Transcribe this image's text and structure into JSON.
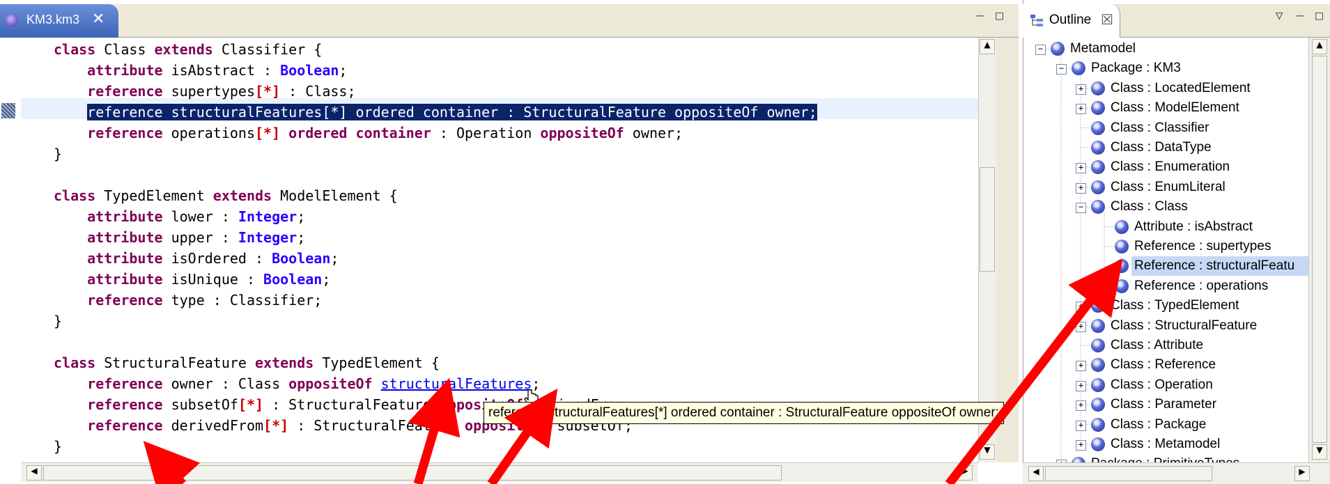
{
  "editor": {
    "tab_title": "KM3.km3",
    "close_glyph": "✕",
    "min_glyph": "–",
    "max_glyph": "□",
    "lines": [
      [
        {
          "t": "class",
          "k": "kw"
        },
        {
          "t": " Class "
        },
        {
          "t": "extends",
          "k": "kw"
        },
        {
          "t": " Classifier {"
        }
      ],
      [
        {
          "t": "    "
        },
        {
          "t": "attribute",
          "k": "kw"
        },
        {
          "t": " isAbstract : "
        },
        {
          "t": "Boolean",
          "k": "kw2"
        },
        {
          "t": ";"
        }
      ],
      [
        {
          "t": "    "
        },
        {
          "t": "reference",
          "k": "kw"
        },
        {
          "t": " supertypes"
        },
        {
          "t": "[*]",
          "k": "br"
        },
        {
          "t": " : Class;"
        }
      ],
      [
        {
          "t": "    "
        },
        {
          "t": "reference structuralFeatures[*] ordered container : StructuralFeature oppositeOf owner;",
          "k": "sel"
        }
      ],
      [
        {
          "t": "    "
        },
        {
          "t": "reference",
          "k": "kw"
        },
        {
          "t": " operations"
        },
        {
          "t": "[*]",
          "k": "br"
        },
        {
          "t": " "
        },
        {
          "t": "ordered container",
          "k": "kw"
        },
        {
          "t": " : Operation "
        },
        {
          "t": "oppositeOf",
          "k": "kw"
        },
        {
          "t": " owner;"
        }
      ],
      [
        {
          "t": "}"
        }
      ],
      [],
      [
        {
          "t": "class",
          "k": "kw"
        },
        {
          "t": " TypedElement "
        },
        {
          "t": "extends",
          "k": "kw"
        },
        {
          "t": " ModelElement {"
        }
      ],
      [
        {
          "t": "    "
        },
        {
          "t": "attribute",
          "k": "kw"
        },
        {
          "t": " lower : "
        },
        {
          "t": "Integer",
          "k": "kw2"
        },
        {
          "t": ";"
        }
      ],
      [
        {
          "t": "    "
        },
        {
          "t": "attribute",
          "k": "kw"
        },
        {
          "t": " upper : "
        },
        {
          "t": "Integer",
          "k": "kw2"
        },
        {
          "t": ";"
        }
      ],
      [
        {
          "t": "    "
        },
        {
          "t": "attribute",
          "k": "kw"
        },
        {
          "t": " isOrdered : "
        },
        {
          "t": "Boolean",
          "k": "kw2"
        },
        {
          "t": ";"
        }
      ],
      [
        {
          "t": "    "
        },
        {
          "t": "attribute",
          "k": "kw"
        },
        {
          "t": " isUnique : "
        },
        {
          "t": "Boolean",
          "k": "kw2"
        },
        {
          "t": ";"
        }
      ],
      [
        {
          "t": "    "
        },
        {
          "t": "reference",
          "k": "kw"
        },
        {
          "t": " type : Classifier;"
        }
      ],
      [
        {
          "t": "}"
        }
      ],
      [],
      [
        {
          "t": "class",
          "k": "kw"
        },
        {
          "t": " StructuralFeature "
        },
        {
          "t": "extends",
          "k": "kw"
        },
        {
          "t": " TypedElement {"
        }
      ],
      [
        {
          "t": "    "
        },
        {
          "t": "reference",
          "k": "kw"
        },
        {
          "t": " owner : Class "
        },
        {
          "t": "oppositeOf",
          "k": "kw"
        },
        {
          "t": " "
        },
        {
          "t": "structuralFeatures",
          "k": "link"
        },
        {
          "t": ";"
        }
      ],
      [
        {
          "t": "    "
        },
        {
          "t": "reference",
          "k": "kw"
        },
        {
          "t": " subsetOf"
        },
        {
          "t": "[*]",
          "k": "br"
        },
        {
          "t": " : StructuralFeature "
        },
        {
          "t": "oppositeOf",
          "k": "kw"
        },
        {
          "t": " derivedFrom;"
        }
      ],
      [
        {
          "t": "    "
        },
        {
          "t": "reference",
          "k": "kw"
        },
        {
          "t": " derivedFrom"
        },
        {
          "t": "[*]",
          "k": "br"
        },
        {
          "t": " : StructuralFeature "
        },
        {
          "t": "oppositeOf",
          "k": "kw"
        },
        {
          "t": " subsetOf;"
        }
      ],
      [
        {
          "t": "}"
        }
      ]
    ],
    "tooltip": "reference structuralFeatures[*] ordered container : StructuralFeature oppositeOf owner;",
    "scroll_up": "▲",
    "scroll_down": "▼",
    "scroll_left": "◀",
    "scroll_right": "▶"
  },
  "outline": {
    "tab_title": "Outline",
    "close_glyph": "☒",
    "menu_glyph": "▽",
    "min_glyph": "–",
    "max_glyph": "□",
    "items": [
      {
        "label": "Metamodel",
        "depth": 0,
        "exp": "−"
      },
      {
        "label": "Package : KM3",
        "depth": 1,
        "exp": "−"
      },
      {
        "label": "Class : LocatedElement",
        "depth": 2,
        "exp": "+"
      },
      {
        "label": "Class : ModelElement",
        "depth": 2,
        "exp": "+"
      },
      {
        "label": "Class : Classifier",
        "depth": 2,
        "exp": ""
      },
      {
        "label": "Class : DataType",
        "depth": 2,
        "exp": ""
      },
      {
        "label": "Class : Enumeration",
        "depth": 2,
        "exp": "+"
      },
      {
        "label": "Class : EnumLiteral",
        "depth": 2,
        "exp": "+"
      },
      {
        "label": "Class : Class",
        "depth": 2,
        "exp": "−"
      },
      {
        "label": "Attribute : isAbstract",
        "depth": 3,
        "exp": ""
      },
      {
        "label": "Reference : supertypes",
        "depth": 3,
        "exp": ""
      },
      {
        "label": "Reference : structuralFeatu",
        "depth": 3,
        "exp": "",
        "selected": true
      },
      {
        "label": "Reference : operations",
        "depth": 3,
        "exp": ""
      },
      {
        "label": "Class : TypedElement",
        "depth": 2,
        "exp": "+"
      },
      {
        "label": "Class : StructuralFeature",
        "depth": 2,
        "exp": "+"
      },
      {
        "label": "Class : Attribute",
        "depth": 2,
        "exp": ""
      },
      {
        "label": "Class : Reference",
        "depth": 2,
        "exp": "+"
      },
      {
        "label": "Class : Operation",
        "depth": 2,
        "exp": "+"
      },
      {
        "label": "Class : Parameter",
        "depth": 2,
        "exp": "+"
      },
      {
        "label": "Class : Package",
        "depth": 2,
        "exp": "+"
      },
      {
        "label": "Class : Metamodel",
        "depth": 2,
        "exp": "+"
      },
      {
        "label": "Package : PrimitiveTypes",
        "depth": 1,
        "exp": "+"
      }
    ]
  },
  "colors": {
    "keyword": "#7f0055",
    "type": "#2a00ff",
    "selection": "#0a246a",
    "annotation_arrow": "#ff0000"
  }
}
